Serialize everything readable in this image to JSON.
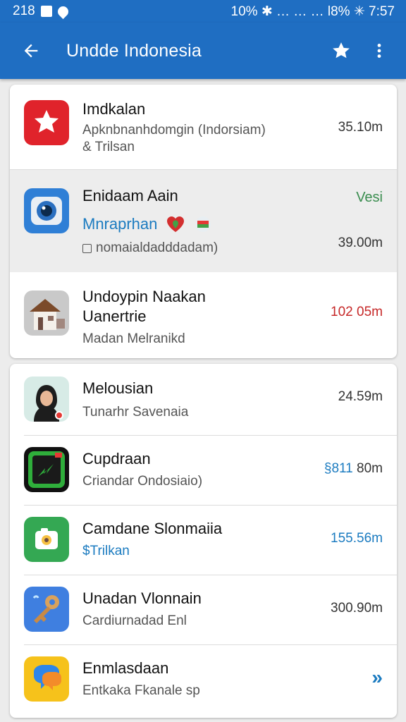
{
  "status_bar": {
    "left_text": "218",
    "right_text": "10% ✱ … … … l8% ✳ 7:57"
  },
  "app_bar": {
    "title": "Undde Indonesia",
    "back_icon": "arrow-left-icon",
    "favorite_icon": "star-icon",
    "menu_icon": "more-vert-icon"
  },
  "colors": {
    "app_bar": "#1f6ec2",
    "accent_blue": "#1b7bc0",
    "accent_red": "#c62828",
    "accent_green": "#3a8d4f"
  },
  "card1": {
    "items": [
      {
        "name": "Imdkalan",
        "subtitle": "Apknbnanhdomgin (Indorsiam)",
        "subtitle2": "& Trilsan",
        "value": "35.10m",
        "icon": "star-app-icon"
      },
      {
        "name": "Enidaam Aain",
        "subtitle": "Mnraprhan",
        "subtitle2": "nomaialdadddadam)",
        "value_top": "Vesi",
        "value": "39.00m",
        "icon": "camera-app-icon"
      },
      {
        "name": "Undoypin Naakan",
        "name2": "Uanertrie",
        "subtitle": "Madan Melranikd",
        "value": "102 05m",
        "icon": "house-app-icon"
      }
    ]
  },
  "card2": {
    "items": [
      {
        "name": "Melousian",
        "subtitle": "Tunarhr Savenaia",
        "value": "24.59m",
        "icon": "avatar-app-icon"
      },
      {
        "name": "Cupdraan",
        "subtitle": "Criandar Ondosiaio)",
        "value_blue": "§811",
        "value": "80m",
        "icon": "arrow-app-icon"
      },
      {
        "name": "Camdane Slonmaiia",
        "subtitle": "$Trilkan",
        "value": "155.56m",
        "icon": "green-app-icon"
      },
      {
        "name": "Unadan Vlonnain",
        "subtitle": "Cardiurnadad Enl",
        "value": "300.90m",
        "icon": "key-app-icon"
      },
      {
        "name": "Enmlasdaan",
        "subtitle": "Entkaka Fkanale sp",
        "value": "»",
        "icon": "chat-app-icon"
      }
    ]
  }
}
